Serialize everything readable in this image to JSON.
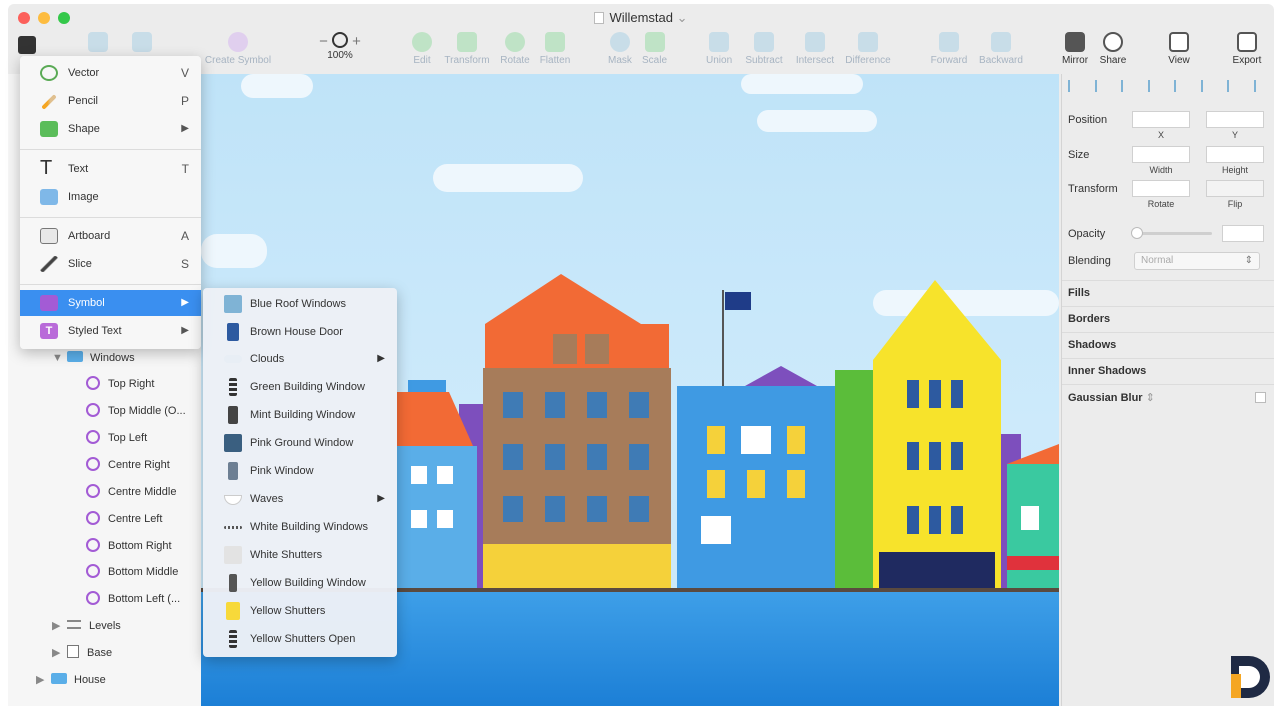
{
  "window": {
    "title": "Willemstad"
  },
  "toolbar": {
    "create_symbol": "Create Symbol",
    "zoom_level": "100%",
    "edit": "Edit",
    "transform": "Transform",
    "rotate": "Rotate",
    "flatten": "Flatten",
    "mask": "Mask",
    "scale": "Scale",
    "union": "Union",
    "subtract": "Subtract",
    "intersect": "Intersect",
    "difference": "Difference",
    "forward": "Forward",
    "backward": "Backward",
    "mirror": "Mirror",
    "share": "Share",
    "view": "View",
    "export": "Export"
  },
  "insert_menu": {
    "items": [
      {
        "label": "Vector",
        "shortcut": "V"
      },
      {
        "label": "Pencil",
        "shortcut": "P"
      },
      {
        "label": "Shape",
        "shortcut": "▶"
      },
      {
        "label": "Text",
        "shortcut": "T"
      },
      {
        "label": "Image",
        "shortcut": ""
      },
      {
        "label": "Artboard",
        "shortcut": "A"
      },
      {
        "label": "Slice",
        "shortcut": "S"
      },
      {
        "label": "Symbol",
        "shortcut": "▶"
      },
      {
        "label": "Styled Text",
        "shortcut": "▶"
      }
    ]
  },
  "symbol_menu": {
    "items": [
      {
        "label": "Blue Roof Windows",
        "arrow": ""
      },
      {
        "label": "Brown House Door",
        "arrow": ""
      },
      {
        "label": "Clouds",
        "arrow": "▶"
      },
      {
        "label": "Green Building Window",
        "arrow": ""
      },
      {
        "label": "Mint Building Window",
        "arrow": ""
      },
      {
        "label": "Pink Ground Window",
        "arrow": ""
      },
      {
        "label": "Pink Window",
        "arrow": ""
      },
      {
        "label": "Waves",
        "arrow": "▶"
      },
      {
        "label": "White Building Windows",
        "arrow": ""
      },
      {
        "label": "White Shutters",
        "arrow": ""
      },
      {
        "label": "Yellow Building Window",
        "arrow": ""
      },
      {
        "label": "Yellow Shutters",
        "arrow": ""
      },
      {
        "label": "Yellow Shutters Open",
        "arrow": ""
      }
    ]
  },
  "layers": {
    "windows_folder": "Windows",
    "symbols": [
      "Top Right",
      "Top Middle (O...",
      "Top Left",
      "Centre Right",
      "Centre Middle",
      "Centre Left",
      "Bottom Right",
      "Bottom Middle",
      "Bottom Left (..."
    ],
    "levels": "Levels",
    "base": "Base",
    "house": "House"
  },
  "inspector": {
    "position": "Position",
    "x": "X",
    "y": "Y",
    "size": "Size",
    "width": "Width",
    "height": "Height",
    "transform": "Transform",
    "rotate": "Rotate",
    "flip": "Flip",
    "opacity": "Opacity",
    "blending": "Blending",
    "blending_value": "Normal",
    "fills": "Fills",
    "borders": "Borders",
    "shadows": "Shadows",
    "inner_shadows": "Inner Shadows",
    "gaussian_blur": "Gaussian Blur"
  },
  "colors": {
    "accent": "#3a8ff0",
    "symbol_purple": "#a35bd5",
    "logo_orange": "#f5a623",
    "logo_navy": "#1f2a44"
  }
}
